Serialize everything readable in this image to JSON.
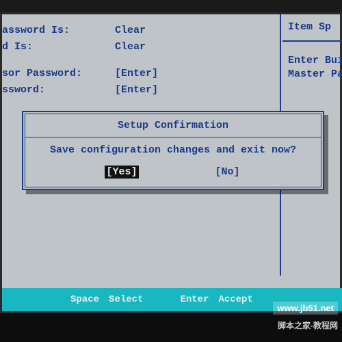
{
  "left": {
    "rows": [
      {
        "label": "assword Is:",
        "value": "Clear"
      },
      {
        "label": "d Is:",
        "value": "Clear"
      }
    ],
    "rows2": [
      {
        "label": "sor Password:",
        "value": "[Enter]"
      },
      {
        "label": "ssword:",
        "value": "[Enter]"
      }
    ]
  },
  "right": {
    "header": "Item Sp",
    "lines": [
      "Enter Bui",
      "Master Pas"
    ]
  },
  "dialog": {
    "title": "Setup Confirmation",
    "message": "Save configuration changes and exit now?",
    "yes": "[Yes]",
    "no": "[No]"
  },
  "footer": {
    "k1": "Space",
    "a1": "Select",
    "k2": "Enter",
    "a2": "Accept"
  },
  "watermark": "www.jb51.net",
  "watermark2": "脚本之家-教程网"
}
